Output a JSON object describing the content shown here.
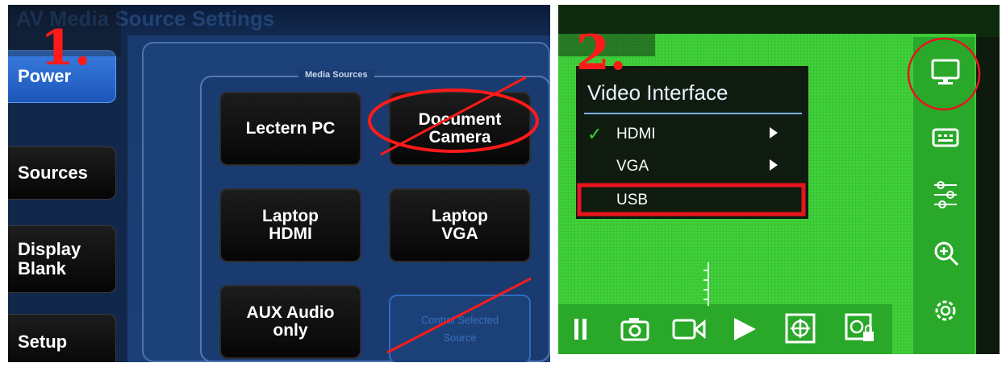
{
  "panel1": {
    "step_label": "1.",
    "header_text": "AV Media Source Settings",
    "sidebar": [
      {
        "label": "Power",
        "active": true
      },
      {
        "label": "Sources",
        "active": false
      },
      {
        "label": "Display\nBlank",
        "active": false
      },
      {
        "label": "Setup",
        "active": false
      }
    ],
    "media_sources_label": "Media Sources",
    "sources": [
      {
        "label": "Lectern PC"
      },
      {
        "label": "Document\nCamera"
      },
      {
        "label": "Laptop\nHDMI"
      },
      {
        "label": "Laptop\nVGA"
      },
      {
        "label": "AUX Audio\nonly"
      },
      {
        "label": "Control Selected\nSource"
      }
    ]
  },
  "panel2": {
    "step_label": "2.",
    "menu": {
      "title": "Video Interface",
      "items": [
        {
          "label": "HDMI",
          "checked": true,
          "has_submenu": true
        },
        {
          "label": "VGA",
          "checked": false,
          "has_submenu": true
        },
        {
          "label": "USB",
          "checked": false,
          "has_submenu": false
        }
      ],
      "check_glyph": "✓"
    },
    "right_toolbar_icons": [
      "monitor-icon",
      "keyboard-icon",
      "sliders-icon",
      "zoom-in-icon",
      "gear-icon"
    ],
    "bottom_toolbar_icons": [
      "pause-icon",
      "camera-icon",
      "video-icon",
      "play-icon",
      "crosshair-icon",
      "lock-frame-icon"
    ]
  },
  "colors": {
    "annotation_red": "#ff1a1a",
    "highlight_box": "#e8141e",
    "check_green": "#39d636",
    "active_blue": "#2d6fd8"
  }
}
